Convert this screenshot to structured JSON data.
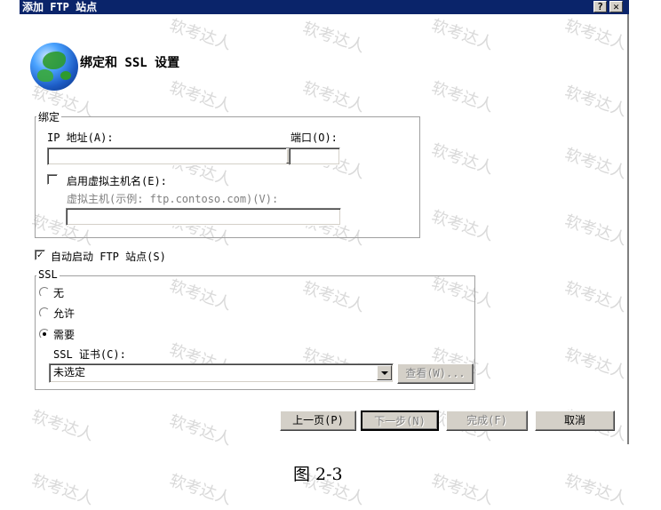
{
  "window": {
    "title": "添加 FTP 站点",
    "help_button": "?",
    "close_button": "✕"
  },
  "header": {
    "title": "绑定和 SSL 设置",
    "icon": "globe-icon"
  },
  "binding_group": {
    "legend": "绑定",
    "ip_label": "IP 地址(A):",
    "ip_value": "",
    "port_label": "端口(O):",
    "port_value": "",
    "vhost_checkbox_label": "启用虚拟主机名(E):",
    "vhost_checked": false,
    "vhost_hint": "虚拟主机(示例: ftp.contoso.com)(V):",
    "vhost_value": ""
  },
  "autostart": {
    "label": "自动启动 FTP 站点(S)",
    "checked": true
  },
  "ssl_group": {
    "legend": "SSL",
    "options": [
      "无",
      "允许",
      "需要"
    ],
    "selected": "需要",
    "cert_label": "SSL 证书(C):",
    "cert_value": "未选定",
    "view_button": "查看(W)..."
  },
  "footer": {
    "prev_button": "上一页(P)",
    "next_button": "下一步(N)",
    "finish_button": "完成(F)",
    "cancel_button": "取消"
  },
  "watermark_text": "软考达人",
  "caption": "图 2-3"
}
